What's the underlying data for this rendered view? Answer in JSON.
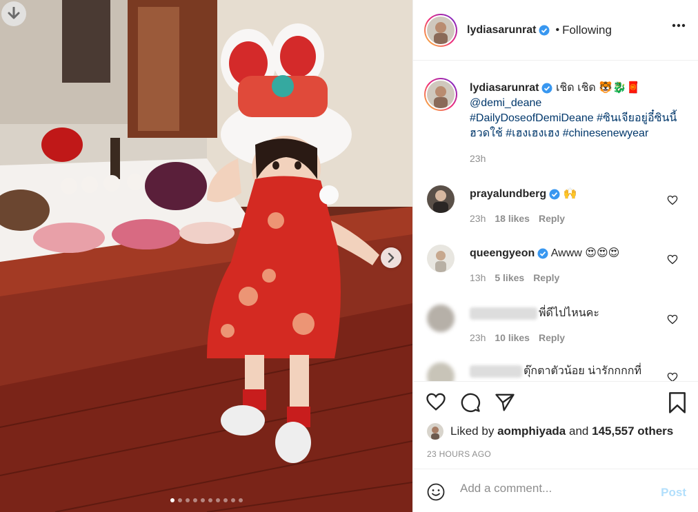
{
  "post": {
    "username": "lydiasarunrat",
    "separator": "•",
    "follow_state": "Following"
  },
  "caption": {
    "username": "lydiasarunrat",
    "text": "เชิด เชิด 🐯🐉🧧",
    "mention": "@demi_deane",
    "hashtags": "#DailyDoseofDemiDeane #ซินเจียอยู่อี๋ซินนี้ฮวดใช้ #เฮงเฮงเฮง #chinesenewyear",
    "time": "23h"
  },
  "comments": [
    {
      "username": "prayalundberg",
      "verified": true,
      "text": "🙌",
      "time": "23h",
      "likes": "18 likes",
      "reply": "Reply"
    },
    {
      "username": "queengyeon",
      "verified": true,
      "text": "Awww 😍😍😍",
      "time": "13h",
      "likes": "5 likes",
      "reply": "Reply"
    },
    {
      "username": "",
      "verified": false,
      "text": "พี่ดีไปไหนคะ",
      "time": "23h",
      "likes": "10 likes",
      "reply": "Reply"
    },
    {
      "username": "",
      "verified": false,
      "text": "ตุ๊กตาตัวน้อย น่ารักกกกที่",
      "time": "",
      "likes": "",
      "reply": ""
    }
  ],
  "likes": {
    "prefix": "Liked by",
    "user": "aomphiyada",
    "and": "and",
    "count": "145,557 others"
  },
  "timestamp": "23 HOURS AGO",
  "add_comment": {
    "placeholder": "Add a comment...",
    "post_label": "Post"
  },
  "carousel": {
    "total": 10,
    "active_index": 0
  },
  "colors": {
    "verified_blue": "#3897f0",
    "link_blue": "#00376b",
    "post_disabled": "#b2dffc",
    "secondary_text": "#8e8e8e"
  },
  "icons": {
    "download": "arrow-down-icon",
    "next": "chevron-right-icon",
    "more": "more-horizontal-icon",
    "like": "heart-icon",
    "comment": "comment-bubble-icon",
    "share": "paper-plane-icon",
    "save": "bookmark-icon",
    "emoji": "smiley-icon"
  }
}
